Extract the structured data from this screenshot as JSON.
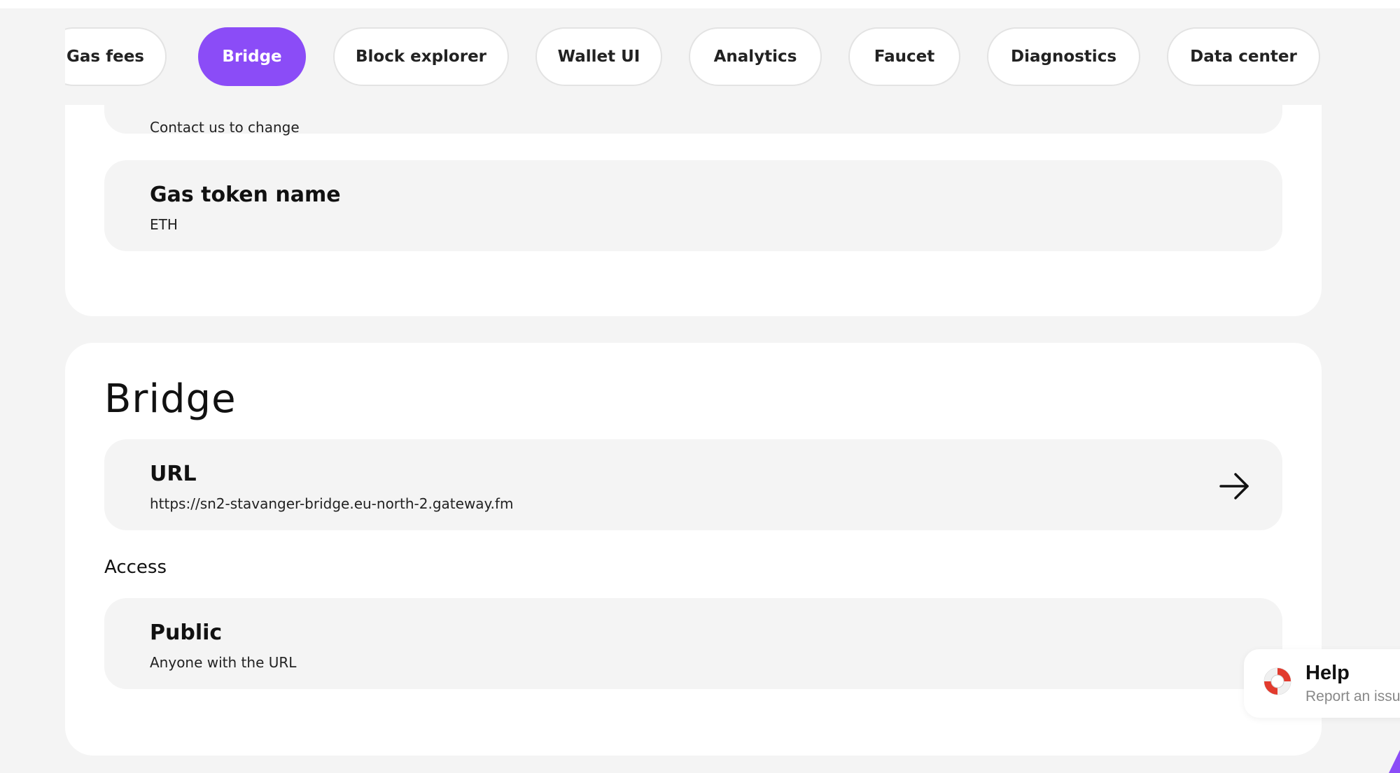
{
  "tabs": [
    {
      "label": "Gas fees",
      "active": false
    },
    {
      "label": "Bridge",
      "active": true
    },
    {
      "label": "Block explorer",
      "active": false
    },
    {
      "label": "Wallet UI",
      "active": false
    },
    {
      "label": "Analytics",
      "active": false
    },
    {
      "label": "Faucet",
      "active": false
    },
    {
      "label": "Diagnostics",
      "active": false
    },
    {
      "label": "Data center",
      "active": false
    }
  ],
  "previous_section": {
    "partial_row_sub": "Contact us to change",
    "gas_token": {
      "title": "Gas token name",
      "value": "ETH"
    }
  },
  "bridge": {
    "heading": "Bridge",
    "url": {
      "title": "URL",
      "value": "https://sn2-stavanger-bridge.eu-north-2.gateway.fm",
      "icon": "arrow-right-icon"
    },
    "access_label": "Access",
    "access": {
      "title": "Public",
      "value": "Anyone with the URL"
    }
  },
  "help": {
    "title": "Help",
    "subtitle": "Report an issue",
    "icon": "lifebuoy-icon"
  },
  "colors": {
    "accent": "#8b4cf7",
    "page_bg": "#f4f4f4",
    "card_bg": "#ffffff"
  }
}
